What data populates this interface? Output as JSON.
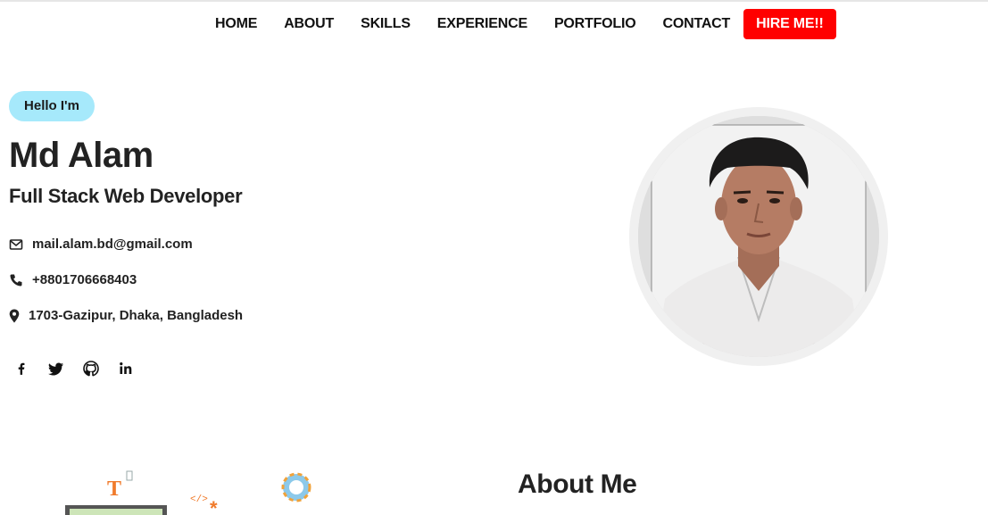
{
  "nav": {
    "items": [
      "HOME",
      "ABOUT",
      "SKILLS",
      "EXPERIENCE",
      "PORTFOLIO",
      "CONTACT"
    ],
    "hire_label": "HIRE ME!!"
  },
  "hero": {
    "greeting": "Hello I'm",
    "name": "Md Alam",
    "role": "Full Stack Web Developer",
    "email": "mail.alam.bd@gmail.com",
    "phone": "+8801706668403",
    "address": "1703-Gazipur, Dhaka, Bangladesh"
  },
  "social": [
    "facebook-icon",
    "twitter-icon",
    "github-icon",
    "linkedin-icon"
  ],
  "about": {
    "title": "About Me"
  },
  "colors": {
    "accent": "#ff0000",
    "greeting_bg": "#a6e9fb",
    "text": "#222222"
  }
}
